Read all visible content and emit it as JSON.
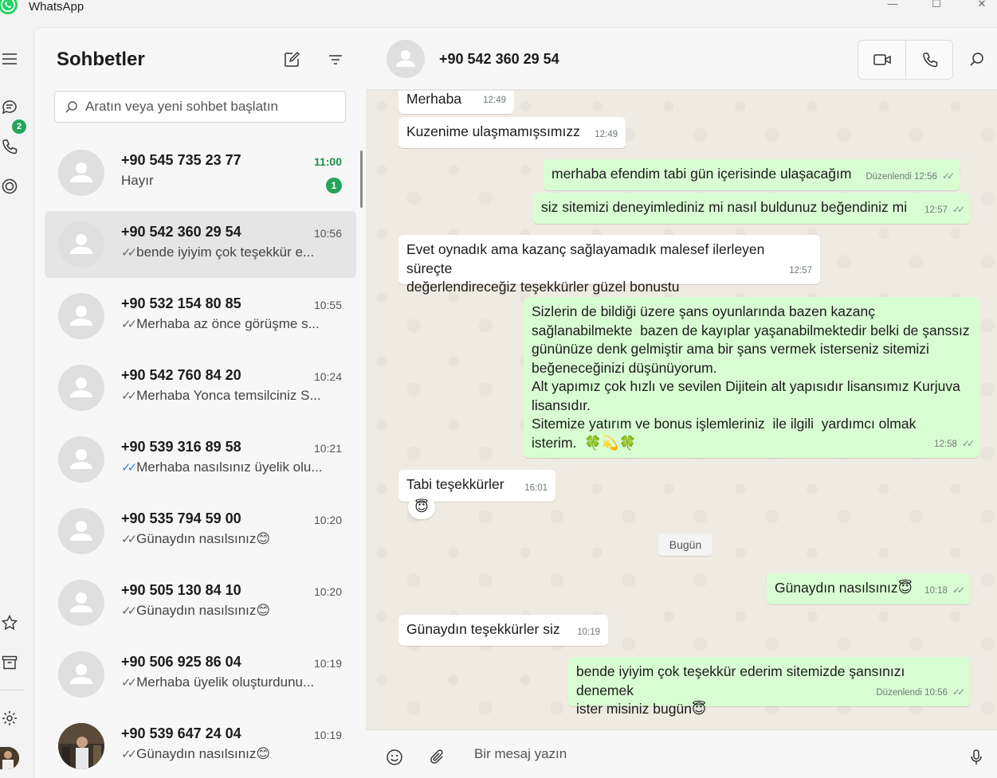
{
  "app": {
    "title": "WhatsApp",
    "window_controls": {
      "minimize": "—",
      "maximize": "☐",
      "close": "✕"
    }
  },
  "rail": {
    "chats_badge": "2",
    "icons": [
      "menu-icon",
      "chats-icon",
      "calls-icon",
      "status-icon",
      "star-icon",
      "archive-icon",
      "gear-icon",
      "profile-avatar"
    ]
  },
  "chatlist": {
    "title": "Sohbetler",
    "search_placeholder": "Aratın veya yeni sohbet başlatın",
    "items": [
      {
        "name": "+90 545 735 23 77",
        "time": "11:00",
        "tick": "",
        "preview": "Hayır",
        "unread": "1"
      },
      {
        "name": "+90 542 360 29 54",
        "time": "10:56",
        "tick": "✓✓",
        "preview": "bende iyiyim çok teşekkür e...",
        "active": true
      },
      {
        "name": "+90 532 154 80 85",
        "time": "10:55",
        "tick": "✓✓",
        "preview": "Merhaba az önce görüşme s..."
      },
      {
        "name": "+90 542 760 84 20",
        "time": "10:24",
        "tick": "✓✓",
        "preview": "Merhaba Yonca temsilciniz S..."
      },
      {
        "name": "+90 539 316 89 58",
        "time": "10:21",
        "tick": "✓✓",
        "tick_color": "blue",
        "preview": "Merhaba nasılsınız üyelik olu..."
      },
      {
        "name": "+90 535 794 59 00",
        "time": "10:20",
        "tick": "✓✓",
        "preview": "Günaydın nasılsınız😊"
      },
      {
        "name": "+90 505 130 84 10",
        "time": "10:20",
        "tick": "✓✓",
        "preview": "Günaydın nasılsınız😊"
      },
      {
        "name": "+90 506 925 86 04",
        "time": "10:19",
        "tick": "✓✓",
        "preview": "Merhaba üyelik oluşturdunu..."
      },
      {
        "name": "+90 539 647 24 04",
        "time": "10:19",
        "tick": "✓✓",
        "preview": "Günaydın nasılsınız😊",
        "photo": true
      }
    ]
  },
  "conversation": {
    "contact_name": "+90 542 360 29 54",
    "messages": [
      {
        "dir": "in",
        "text": "Merhaba",
        "meta": "12:49"
      },
      {
        "dir": "in",
        "text": "Kuzenime ulaşmamışsımızz",
        "meta": "12:49"
      },
      {
        "dir": "out",
        "text": "merhaba efendim tabi gün içerisinde ulaşacağım",
        "meta": "Düzenlendi 12:56",
        "tick": "✓✓"
      },
      {
        "dir": "out",
        "text": "siz sitemizi deneyimlediniz mi nasıl buldunuz beğendiniz mi",
        "meta": "12:57",
        "tick": "✓✓"
      },
      {
        "dir": "in",
        "text": "Evet oynadık ama kazanç sağlayamadık malesef ilerleyen süreçte\ndeğerlendireceğiz teşekkürler güzel bonustu",
        "meta": "12:57"
      },
      {
        "dir": "out",
        "text": "Sizlerin de bildiği üzere şans oyunlarında bazen kazanç\nsağlanabilmekte  bazen de kayıplar yaşanabilmektedir belki de şanssız\ngününüze denk gelmiştir ama bir şans vermek isterseniz sitemizi\nbeğeneceğinizi düşünüyorum.\nAlt yapımız çok hızlı ve sevilen Dijitein alt yapısıdır lisansımız Kurjuva\nlisansıdır.\nSitemize yatırım ve bonus işlemleriniz  ile ilgili  yardımcı olmak\nisterim.  🍀💫🍀",
        "meta": "12:58",
        "tick": "✓✓"
      },
      {
        "dir": "in",
        "text": "Tabi teşekkürler",
        "meta": "16:01",
        "reaction": "😇"
      },
      {
        "dir": "out",
        "text": "Günaydın nasılsınız😇",
        "meta": "10:18",
        "tick": "✓✓"
      },
      {
        "dir": "in",
        "text": "Günaydın teşekkürler siz",
        "meta": "10:19"
      },
      {
        "dir": "out",
        "text": "bende iyiyim çok teşekkür ederim sitemizde şansınızı denemek\nister misiniz bugün😇",
        "meta": "Düzenlendi 10:56",
        "tick": "✓✓"
      }
    ],
    "date_separator": "Bugün",
    "composer_placeholder": "Bir mesaj yazın"
  },
  "colors": {
    "accent_green": "#25a55b",
    "outgoing_bubble": "#d9fdd3",
    "incoming_bubble": "#ffffff",
    "chat_background": "#efeae2",
    "read_tick_blue": "#2b8be6"
  }
}
